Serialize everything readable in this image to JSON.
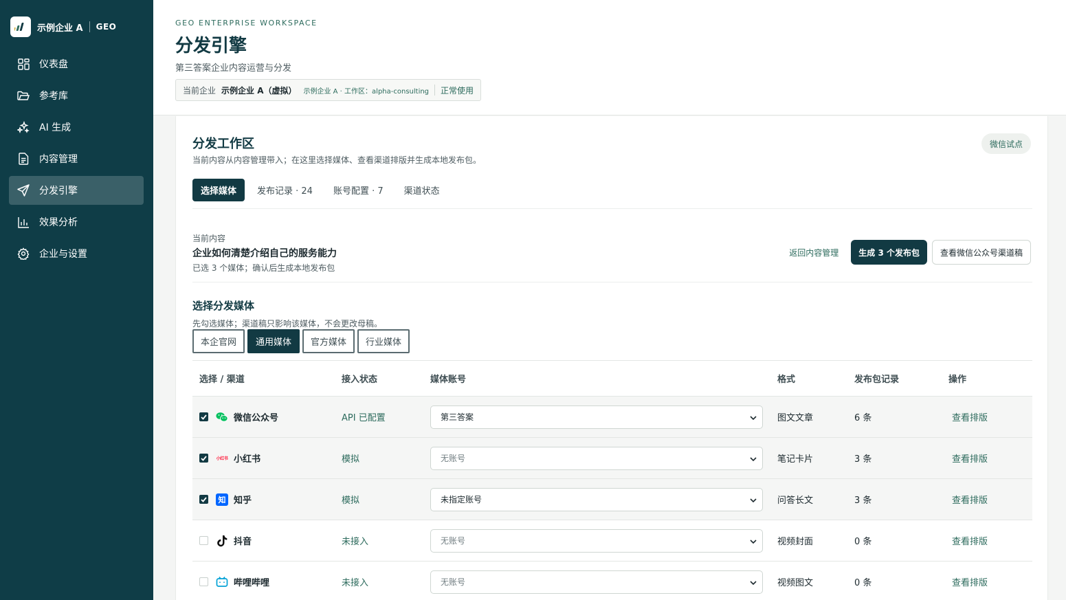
{
  "brand": {
    "name": "示例企业 A",
    "product": "GEO"
  },
  "nav": [
    {
      "label": "仪表盘",
      "icon": "dashboard-icon",
      "active": false
    },
    {
      "label": "参考库",
      "icon": "folder-icon",
      "active": false
    },
    {
      "label": "AI 生成",
      "icon": "sparkle-icon",
      "active": false
    },
    {
      "label": "内容管理",
      "icon": "document-icon",
      "active": false
    },
    {
      "label": "分发引擎",
      "icon": "send-icon",
      "active": true
    },
    {
      "label": "效果分析",
      "icon": "bar-chart-icon",
      "active": false
    },
    {
      "label": "企业与设置",
      "icon": "gear-icon",
      "active": false
    }
  ],
  "header": {
    "eyebrow": "GEO ENTERPRISE WORKSPACE",
    "title": "分发引擎",
    "subtitle": "第三答案企业内容运营与分发",
    "enterprise": {
      "label": "当前企业",
      "name": "示例企业 A（虚拟）",
      "workspace": "示例企业 A · 工作区：alpha-consulting",
      "status": "正常使用"
    }
  },
  "workspace": {
    "title": "分发工作区",
    "subtitle": "当前内容从内容管理带入；在这里选择媒体、查看渠道排版并生成本地发布包。",
    "pill": "微信试点",
    "tabs": [
      {
        "label": "选择媒体",
        "active": true
      },
      {
        "label": "发布记录 · 24",
        "active": false
      },
      {
        "label": "账号配置 · 7",
        "active": false
      },
      {
        "label": "渠道状态",
        "active": false
      }
    ]
  },
  "current": {
    "label": "当前内容",
    "title": "企业如何清楚介绍自己的服务能力",
    "subtitle": "已选 3 个媒体；确认后生成本地发布包",
    "back_link": "返回内容管理",
    "primary_button": "生成 3 个发布包",
    "secondary_button": "查看微信公众号渠道稿"
  },
  "media": {
    "title": "选择分发媒体",
    "subtitle": "先勾选媒体；渠道稿只影响该媒体，不会更改母稿。",
    "segments": [
      {
        "label": "本企官网",
        "active": false
      },
      {
        "label": "通用媒体",
        "active": true
      },
      {
        "label": "官方媒体",
        "active": false
      },
      {
        "label": "行业媒体",
        "active": false
      }
    ]
  },
  "table": {
    "headers": [
      "选择 / 渠道",
      "接入状态",
      "媒体账号",
      "格式",
      "发布包记录",
      "操作"
    ],
    "rows": [
      {
        "checked": true,
        "icon": "wechat-icon",
        "channel": "微信公众号",
        "status": "API 已配置",
        "account": "第三答案",
        "account_placeholder": false,
        "format": "图文文章",
        "records": "6 条",
        "action": "查看排版"
      },
      {
        "checked": true,
        "icon": "xiaohongshu-icon",
        "icon_text": "小红书",
        "channel": "小红书",
        "status": "模拟",
        "account": "无账号",
        "account_placeholder": true,
        "format": "笔记卡片",
        "records": "3 条",
        "action": "查看排版"
      },
      {
        "checked": true,
        "icon": "zhihu-icon",
        "icon_text": "知",
        "channel": "知乎",
        "status": "模拟",
        "account": "未指定账号",
        "account_placeholder": false,
        "format": "问答长文",
        "records": "3 条",
        "action": "查看排版"
      },
      {
        "checked": false,
        "icon": "douyin-icon",
        "channel": "抖音",
        "status": "未接入",
        "account": "无账号",
        "account_placeholder": true,
        "format": "视频封面",
        "records": "0 条",
        "action": "查看排版"
      },
      {
        "checked": false,
        "icon": "bilibili-icon",
        "channel": "哔哩哔哩",
        "status": "未接入",
        "account": "无账号",
        "account_placeholder": true,
        "format": "视频图文",
        "records": "0 条",
        "action": "查看排版"
      }
    ]
  },
  "colors": {
    "sidebar": "#0f3d47",
    "primary": "#123a43",
    "accent": "#2d6b5d",
    "wechat": "#07c160",
    "xiaohongshu": "#ff2442",
    "zhihu": "#0066ff",
    "bilibili": "#00a1d6"
  }
}
